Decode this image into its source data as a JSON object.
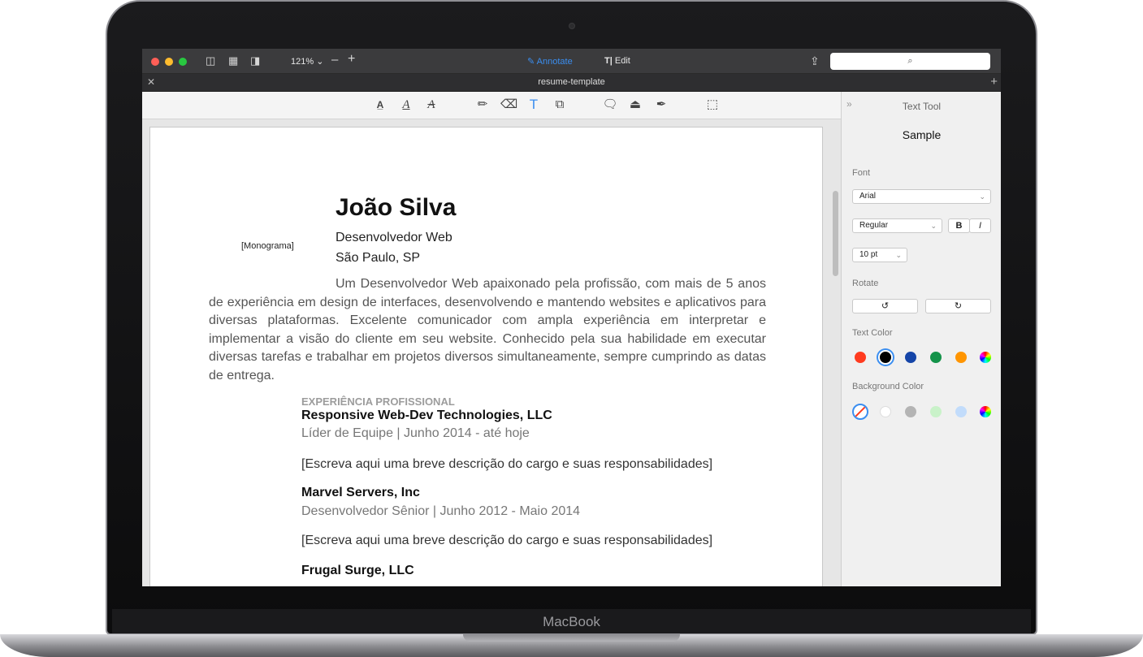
{
  "device": {
    "brand": "MacBook"
  },
  "window": {
    "zoom": "121%",
    "modes": {
      "annotate": "Annotate",
      "edit": "Edit"
    },
    "tab_title": "resume-template",
    "colors": {
      "accent": "#3b8ef0",
      "titlebar": "#3b3b3d",
      "close": "#ff5f57",
      "minimize": "#febc2e",
      "zoom": "#28c840"
    }
  },
  "toolbar": {
    "icons": [
      "text-highlight-icon",
      "text-underline-icon",
      "text-strikethrough-icon",
      "pencil-icon",
      "eraser-icon",
      "text-tool-icon",
      "shapes-icon",
      "note-icon",
      "stamp-icon",
      "signature-icon",
      "selection-icon"
    ]
  },
  "document": {
    "name": "João Silva",
    "role": "Desenvolvedor Web",
    "city": "São Paulo, SP",
    "monogram": "[Monograma]",
    "summary": "Um Desenvolvedor Web apaixonado pela profissão, com mais de 5 anos de experiência em design de interfaces, desenvolvendo e mantendo websites e aplicativos para diversas plataformas. Excelente comunicador com ampla experiência em interpretar e implementar a visão do cliente em seu website. Conhecido pela sua habilidade em executar diversas tarefas e trabalhar em projetos diversos simultaneamente, sempre cumprindo as datas de entrega.",
    "section_title": "EXPERIÊNCIA PROFISSIONAL",
    "jobs": [
      {
        "company": "Responsive Web-Dev Technologies, LLC",
        "detail": "Líder de Equipe | Junho 2014 - até hoje",
        "description": "[Escreva aqui uma breve descrição do cargo e suas responsabilidades]"
      },
      {
        "company": "Marvel Servers, Inc",
        "detail": "Desenvolvedor Sênior | Junho  2012 - Maio 2014",
        "description": "[Escreva aqui uma breve descrição do cargo e suas responsabilidades]"
      },
      {
        "company": "Frugal Surge, LLC"
      }
    ]
  },
  "panel": {
    "title": "Text Tool",
    "sample": "Sample",
    "font_label": "Font",
    "font_value": "Arial",
    "style_value": "Regular",
    "bold": "B",
    "italic": "I",
    "size_value": "10 pt",
    "rotate_label": "Rotate",
    "text_color_label": "Text Color",
    "text_colors": [
      "#ff3b1f",
      "#000000",
      "#1545a8",
      "#14934a",
      "#ff9500"
    ],
    "background_color_label": "Background Color",
    "background_colors": [
      "#ffffff",
      "#b4b4b4",
      "#c9f2c9",
      "#c2dcfb"
    ]
  }
}
